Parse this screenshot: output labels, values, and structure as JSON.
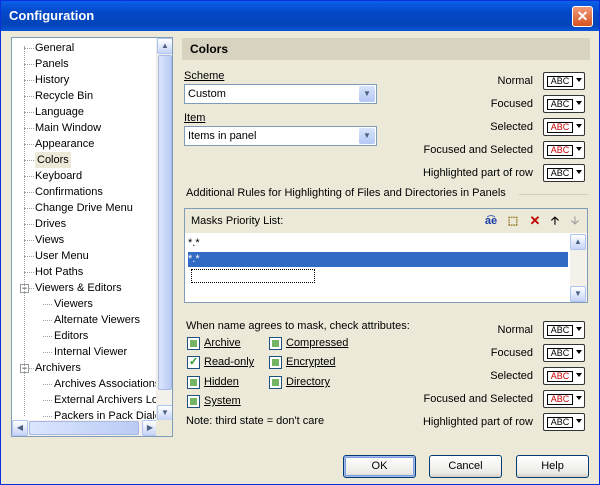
{
  "window": {
    "title": "Configuration"
  },
  "tree": {
    "items": [
      {
        "label": "General",
        "level": 1
      },
      {
        "label": "Panels",
        "level": 1
      },
      {
        "label": "History",
        "level": 1
      },
      {
        "label": "Recycle Bin",
        "level": 1
      },
      {
        "label": "Language",
        "level": 1
      },
      {
        "label": "Main Window",
        "level": 1
      },
      {
        "label": "Appearance",
        "level": 1
      },
      {
        "label": "Colors",
        "level": 1,
        "selected": true
      },
      {
        "label": "Keyboard",
        "level": 1
      },
      {
        "label": "Confirmations",
        "level": 1
      },
      {
        "label": "Change Drive Menu",
        "level": 1
      },
      {
        "label": "Drives",
        "level": 1
      },
      {
        "label": "Views",
        "level": 1
      },
      {
        "label": "User Menu",
        "level": 1
      },
      {
        "label": "Hot Paths",
        "level": 1
      },
      {
        "label": "Viewers & Editors",
        "level": 1,
        "expandable": true
      },
      {
        "label": "Viewers",
        "level": 2
      },
      {
        "label": "Alternate Viewers",
        "level": 2
      },
      {
        "label": "Editors",
        "level": 2
      },
      {
        "label": "Internal Viewer",
        "level": 2
      },
      {
        "label": "Archivers",
        "level": 1,
        "expandable": true
      },
      {
        "label": "Archives Associations",
        "level": 2
      },
      {
        "label": "External Archivers Lo",
        "level": 2
      },
      {
        "label": "Packers in Pack Dialo",
        "level": 2
      }
    ]
  },
  "panel": {
    "title": "Colors",
    "scheme_label": "Scheme",
    "scheme_value": "Custom",
    "item_label": "Item",
    "item_value": "Items in panel",
    "color_rows": [
      "Normal",
      "Focused",
      "Selected",
      "Focused and Selected",
      "Highlighted part of row"
    ],
    "abc_text": "ABC",
    "rules_title": "Additional Rules for Highlighting of Files and Directories in Panels",
    "masks_label": "Masks Priority List:",
    "masks": [
      "*.*",
      "*.*"
    ],
    "attr_intro": "When name agrees to mask, check attributes:",
    "attributes": {
      "archive": "Archive",
      "readonly": "Read-only",
      "hidden": "Hidden",
      "system": "System",
      "compressed": "Compressed",
      "encrypted": "Encrypted",
      "directory": "Directory"
    },
    "note": "Note: third state = don't care",
    "mask_color_rows": [
      "Normal",
      "Focused",
      "Selected",
      "Focused and Selected",
      "Highlighted part of row"
    ]
  },
  "buttons": {
    "ok": "OK",
    "cancel": "Cancel",
    "help": "Help"
  },
  "icons": {
    "close": "close-icon",
    "tools": [
      "rename-icon",
      "new-item-icon",
      "delete-icon",
      "move-up-icon",
      "move-down-icon"
    ]
  },
  "colors": {
    "abc_normal": "#000000",
    "abc_focused": "#000000",
    "abc_selected": "#cc0000",
    "abc_focused_selected": "#cc0000",
    "abc_highlight": "#000000",
    "abc_selected_bg_normal": "#ffffff",
    "abc_focused_bg": "#ffffff"
  }
}
